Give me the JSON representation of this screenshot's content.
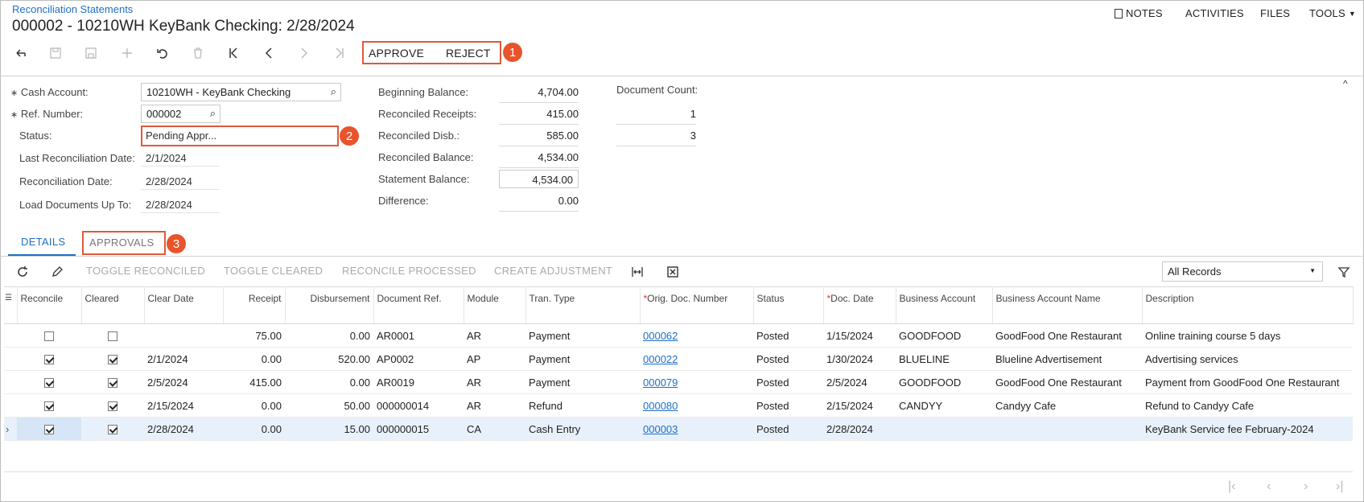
{
  "header": {
    "breadcrumb": "Reconciliation Statements",
    "title": "000002 - 10210WH KeyBank Checking: 2/28/2024",
    "nav": {
      "notes": "NOTES",
      "activities": "ACTIVITIES",
      "files": "FILES",
      "tools": "TOOLS"
    }
  },
  "toolbar": {
    "approve": "APPROVE",
    "reject": "REJECT",
    "callouts": [
      "1",
      "2",
      "3"
    ]
  },
  "form": {
    "cash_account": {
      "label": "Cash Account:",
      "value": "10210WH - KeyBank Checking"
    },
    "ref_number": {
      "label": "Ref. Number:",
      "value": "000002"
    },
    "status": {
      "label": "Status:",
      "value": "Pending Appr..."
    },
    "last_recon_date": {
      "label": "Last Reconciliation Date:",
      "value": "2/1/2024"
    },
    "recon_date": {
      "label": "Reconciliation Date:",
      "value": "2/28/2024"
    },
    "load_docs": {
      "label": "Load Documents Up To:",
      "value": "2/28/2024"
    },
    "beginning_balance": {
      "label": "Beginning Balance:",
      "value": "4,704.00"
    },
    "reconciled_receipts": {
      "label": "Reconciled Receipts:",
      "value": "415.00"
    },
    "reconciled_disb": {
      "label": "Reconciled Disb.:",
      "value": "585.00"
    },
    "reconciled_balance": {
      "label": "Reconciled Balance:",
      "value": "4,534.00"
    },
    "statement_balance": {
      "label": "Statement Balance:",
      "value": "4,534.00"
    },
    "difference": {
      "label": "Difference:",
      "value": "0.00"
    },
    "document_count": {
      "label": "Document Count:",
      "receipts": "1",
      "disb": "3"
    }
  },
  "tabs": {
    "details": "DETAILS",
    "approvals": "APPROVALS"
  },
  "grid_toolbar": {
    "toggle_reconciled": "TOGGLE RECONCILED",
    "toggle_cleared": "TOGGLE CLEARED",
    "reconcile_processed": "RECONCILE PROCESSED",
    "create_adjustment": "CREATE ADJUSTMENT",
    "filter_value": "All Records"
  },
  "grid": {
    "columns": {
      "reconcile": "Reconcile",
      "cleared": "Cleared",
      "clear_date": "Clear Date",
      "receipt": "Receipt",
      "disbursement": "Disbursement",
      "document_ref": "Document Ref.",
      "module": "Module",
      "tran_type": "Tran. Type",
      "orig_doc_number": "Orig. Doc. Number",
      "status": "Status",
      "doc_date": "Doc. Date",
      "business_account": "Business Account",
      "business_account_name": "Business Account Name",
      "description": "Description"
    },
    "rows": [
      {
        "reconcile": false,
        "cleared": false,
        "clear_date": "",
        "receipt": "75.00",
        "disbursement": "0.00",
        "document_ref": "AR0001",
        "module": "AR",
        "tran_type": "Payment",
        "orig_doc_number": "000062",
        "status": "Posted",
        "doc_date": "1/15/2024",
        "business_account": "GOODFOOD",
        "business_account_name": "GoodFood One Restaurant",
        "description": "Online training course 5 days"
      },
      {
        "reconcile": true,
        "cleared": true,
        "clear_date": "2/1/2024",
        "receipt": "0.00",
        "disbursement": "520.00",
        "document_ref": "AP0002",
        "module": "AP",
        "tran_type": "Payment",
        "orig_doc_number": "000022",
        "status": "Posted",
        "doc_date": "1/30/2024",
        "business_account": "BLUELINE",
        "business_account_name": "Blueline Advertisement",
        "description": "Advertising services"
      },
      {
        "reconcile": true,
        "cleared": true,
        "clear_date": "2/5/2024",
        "receipt": "415.00",
        "disbursement": "0.00",
        "document_ref": "AR0019",
        "module": "AR",
        "tran_type": "Payment",
        "orig_doc_number": "000079",
        "status": "Posted",
        "doc_date": "2/5/2024",
        "business_account": "GOODFOOD",
        "business_account_name": "GoodFood One Restaurant",
        "description": "Payment from GoodFood One Restaurant"
      },
      {
        "reconcile": true,
        "cleared": true,
        "clear_date": "2/15/2024",
        "receipt": "0.00",
        "disbursement": "50.00",
        "document_ref": "000000014",
        "module": "AR",
        "tran_type": "Refund",
        "orig_doc_number": "000080",
        "status": "Posted",
        "doc_date": "2/15/2024",
        "business_account": "CANDYY",
        "business_account_name": "Candyy Cafe",
        "description": "Refund to Candyy Cafe"
      },
      {
        "reconcile": true,
        "cleared": true,
        "clear_date": "2/28/2024",
        "receipt": "0.00",
        "disbursement": "15.00",
        "document_ref": "000000015",
        "module": "CA",
        "tran_type": "Cash Entry",
        "orig_doc_number": "000003",
        "status": "Posted",
        "doc_date": "2/28/2024",
        "business_account": "",
        "business_account_name": "",
        "description": "KeyBank Service fee February-2024"
      }
    ]
  },
  "colors": {
    "accent": "#1f6fc5",
    "callout": "#e8542b",
    "selected_row": "#e8f1fb"
  }
}
